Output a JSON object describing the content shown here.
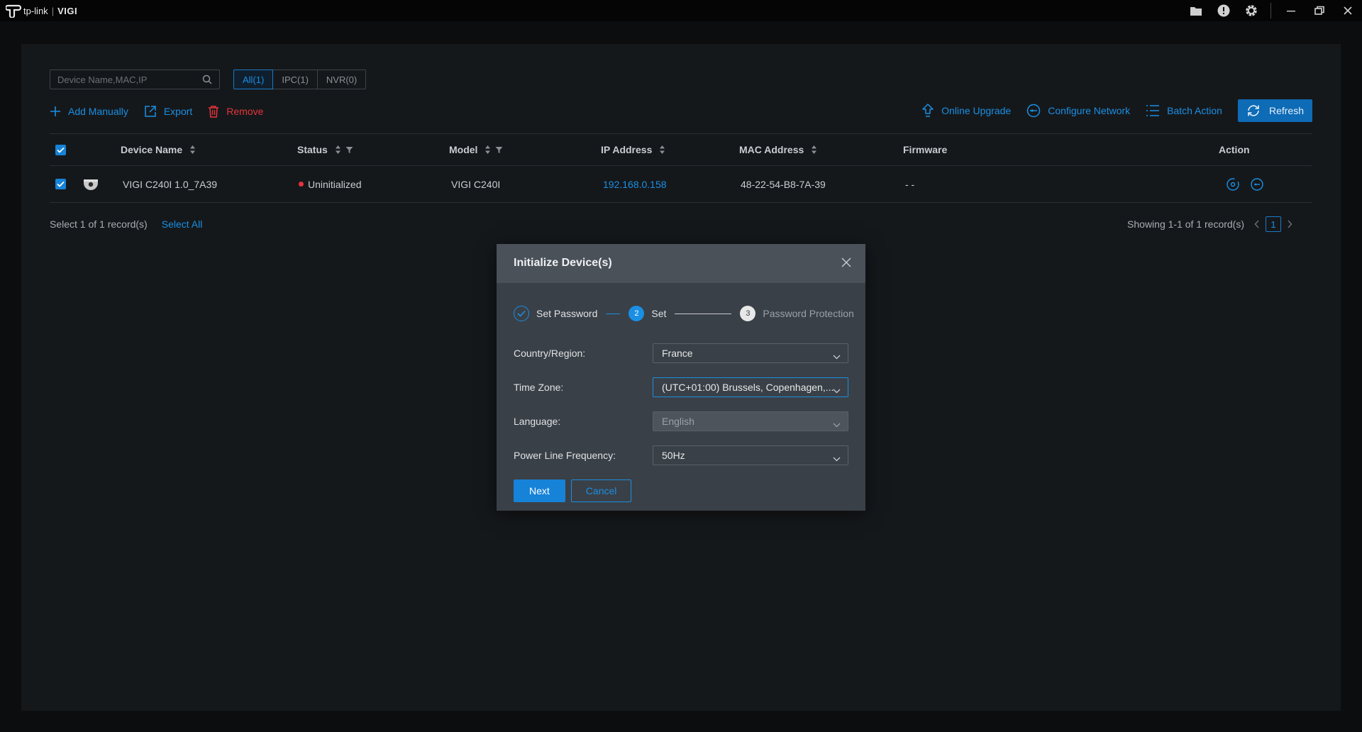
{
  "app": {
    "brand": "tp-link",
    "product": "VIGI"
  },
  "search": {
    "placeholder": "Device Name,MAC,IP"
  },
  "filters": [
    "All(1)",
    "IPC(1)",
    "NVR(0)"
  ],
  "toolbar": {
    "add_manually": "Add Manually",
    "export": "Export",
    "remove": "Remove",
    "online_upgrade": "Online Upgrade",
    "configure_network": "Configure Network",
    "batch_action": "Batch Action",
    "refresh": "Refresh"
  },
  "table": {
    "headers": {
      "device_name": "Device Name",
      "status": "Status",
      "model": "Model",
      "ip": "IP Address",
      "mac": "MAC Address",
      "firmware": "Firmware",
      "action": "Action"
    },
    "rows": [
      {
        "device_name": "VIGI C240I 1.0_7A39",
        "status": "Uninitialized",
        "model": "VIGI C240I",
        "ip": "192.168.0.158",
        "mac": "48-22-54-B8-7A-39",
        "firmware": "- -"
      }
    ]
  },
  "footer": {
    "selection": "Select 1 of 1 record(s)",
    "select_all": "Select All",
    "showing": "Showing 1-1 of 1 record(s)",
    "page": "1"
  },
  "modal": {
    "title": "Initialize Device(s)",
    "steps": [
      {
        "num": "",
        "label": "Set Password"
      },
      {
        "num": "2",
        "label": "Set"
      },
      {
        "num": "3",
        "label": "Password Protection"
      }
    ],
    "fields": {
      "country": {
        "label": "Country/Region:",
        "value": "France"
      },
      "timezone": {
        "label": "Time Zone:",
        "value": "(UTC+01:00) Brussels, Copenhagen,..."
      },
      "language": {
        "label": "Language:",
        "value": "English"
      },
      "power": {
        "label": "Power Line Frequency:",
        "value": "50Hz"
      }
    },
    "next": "Next",
    "cancel": "Cancel"
  },
  "colors": {
    "accent": "#1a8fe3",
    "danger": "#e5343a",
    "panel": "#15181b",
    "modal": "#3a4047"
  }
}
